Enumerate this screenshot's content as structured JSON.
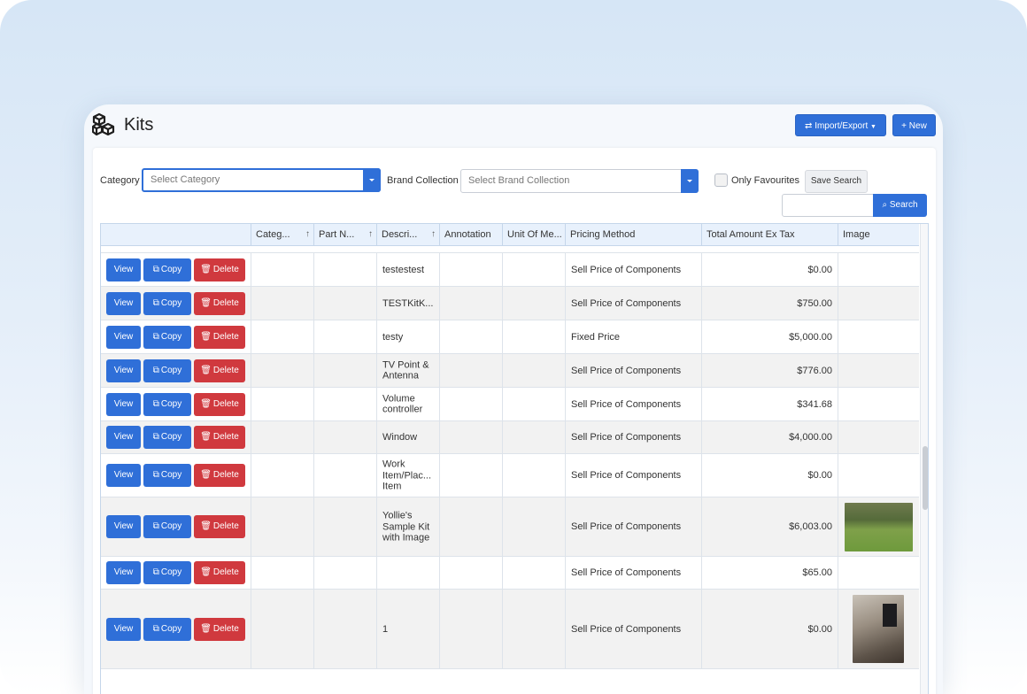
{
  "app": {
    "title": "Kits",
    "import_export_label": "Import/Export",
    "new_label": "New"
  },
  "filters": {
    "category_label": "Category",
    "category_placeholder": "Select Category",
    "brand_label": "Brand Collection",
    "brand_placeholder": "Select Brand Collection",
    "favourites_label": "Only Favourites",
    "save_search_label": "Save Search",
    "search_label": "Search",
    "search_value": ""
  },
  "table": {
    "columns": [
      "Categ...",
      "Part N...",
      "Descri...",
      "Annotation",
      "Unit Of Me...",
      "Pricing Method",
      "Total Amount Ex Tax",
      "Image"
    ],
    "buttons": {
      "view": "View",
      "copy": "Copy",
      "delete": "Delete"
    },
    "rows": [
      {
        "description": "testestest",
        "pricing": "Sell Price of Components",
        "total": "$0.00",
        "image": ""
      },
      {
        "description": "TESTKitK...",
        "pricing": "Sell Price of Components",
        "total": "$750.00",
        "image": ""
      },
      {
        "description": "testy",
        "pricing": "Fixed Price",
        "total": "$5,000.00",
        "image": ""
      },
      {
        "description": "TV Point & Antenna",
        "pricing": "Sell Price of Components",
        "total": "$776.00",
        "image": ""
      },
      {
        "description": "Volume controller",
        "pricing": "Sell Price of Components",
        "total": "$341.68",
        "image": ""
      },
      {
        "description": "Window",
        "pricing": "Sell Price of Components",
        "total": "$4,000.00",
        "image": ""
      },
      {
        "description": "Work Item/Plac... Item",
        "pricing": "Sell Price of Components",
        "total": "$0.00",
        "image": ""
      },
      {
        "description": "Yollie's Sample Kit with Image",
        "pricing": "Sell Price of Components",
        "total": "$6,003.00",
        "image": "lawn-photo"
      },
      {
        "description": "",
        "pricing": "Sell Price of Components",
        "total": "$65.00",
        "image": ""
      },
      {
        "description": "1",
        "pricing": "Sell Price of Components",
        "total": "$0.00",
        "image": "room-photo"
      }
    ]
  },
  "colors": {
    "primary": "#2f6fd8",
    "danger": "#d0393e",
    "header_bg": "#e8f1fc"
  }
}
